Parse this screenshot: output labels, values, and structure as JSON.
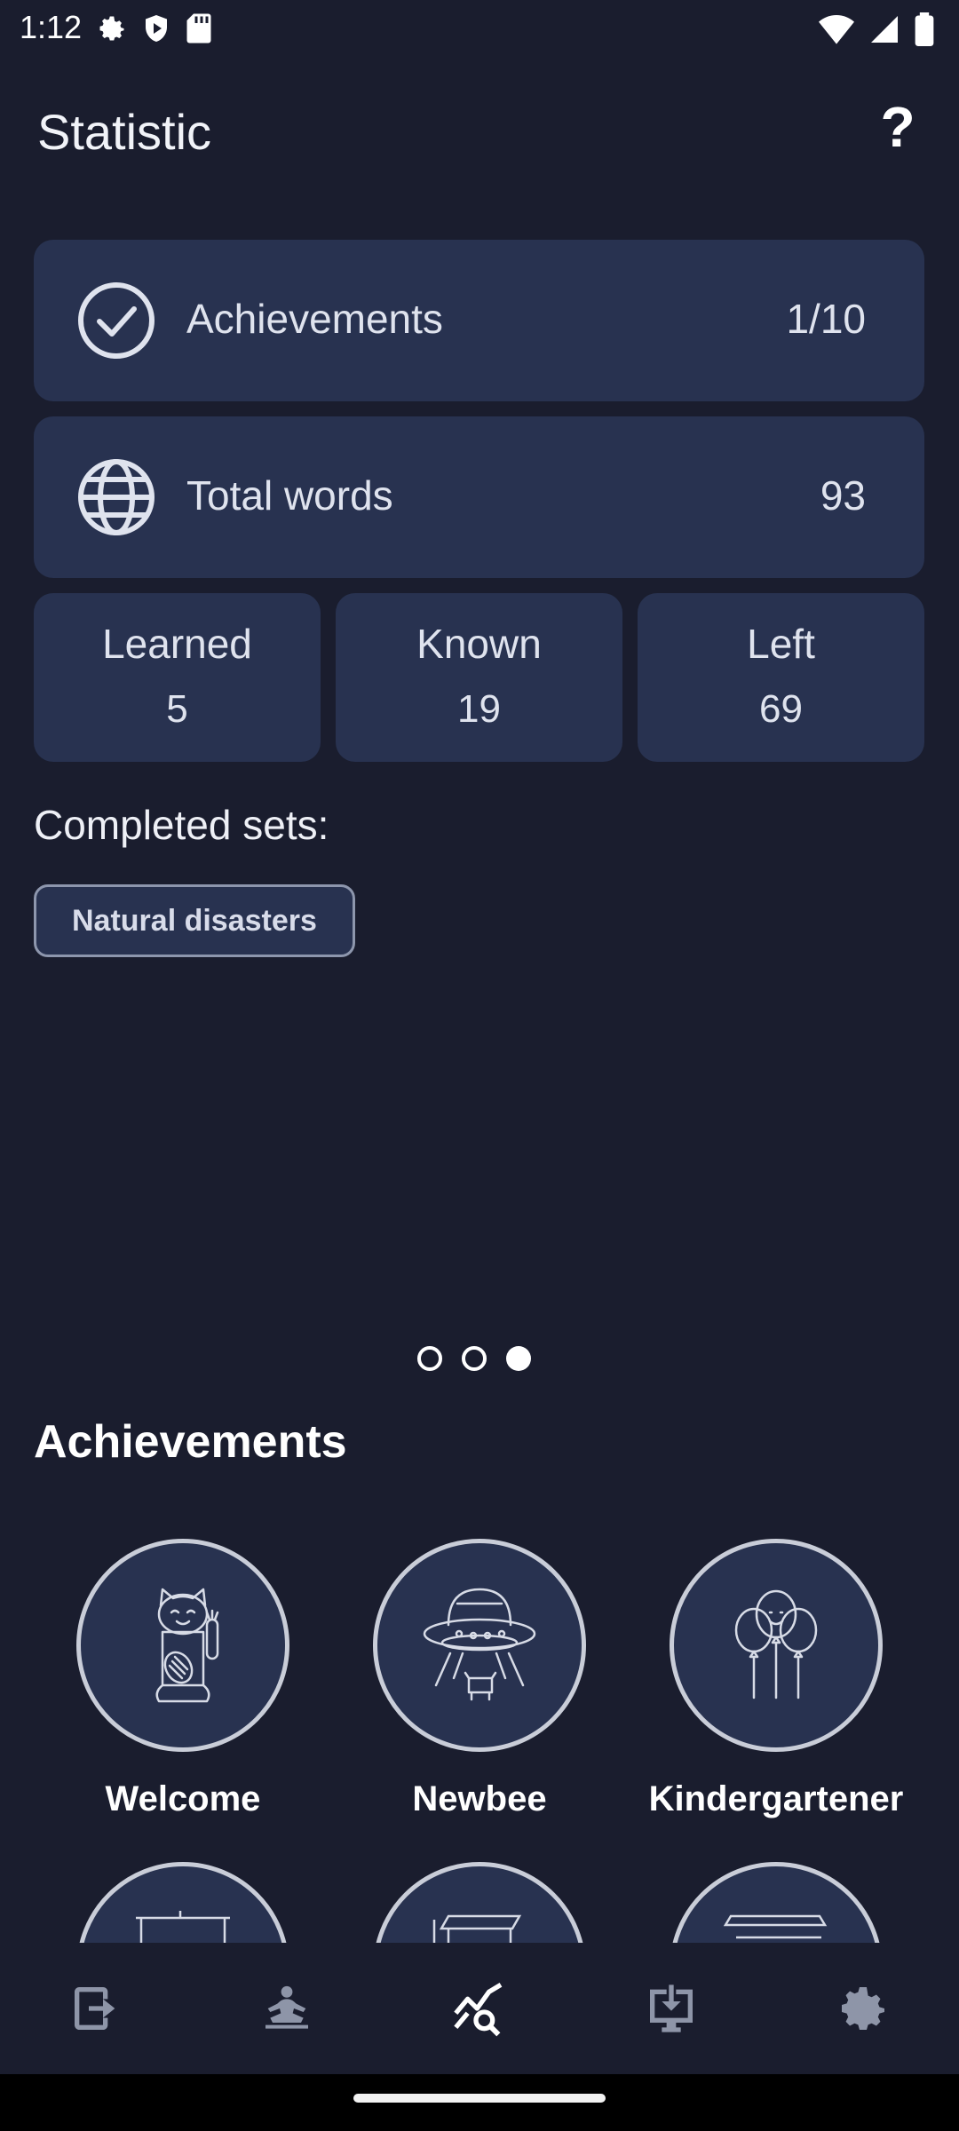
{
  "status_bar": {
    "time": "1:12"
  },
  "header": {
    "title": "Statistic",
    "help_label": "?"
  },
  "stats": {
    "achievements": {
      "label": "Achievements",
      "value": "1/10"
    },
    "total_words": {
      "label": "Total words",
      "value": "93"
    },
    "learned": {
      "label": "Learned",
      "value": "5"
    },
    "known": {
      "label": "Known",
      "value": "19"
    },
    "left": {
      "label": "Left",
      "value": "69"
    }
  },
  "completed_sets": {
    "title": "Completed sets:",
    "items": [
      "Natural disasters"
    ]
  },
  "pager": {
    "count": 3,
    "active_index": 2
  },
  "achievements_section": {
    "title": "Achievements",
    "badges": [
      {
        "label": "Welcome",
        "icon": "lucky-cat-icon"
      },
      {
        "label": "Newbee",
        "icon": "ufo-icon"
      },
      {
        "label": "Kindergartener",
        "icon": "balloons-icon"
      }
    ]
  },
  "bottom_nav": {
    "items": [
      "exit-icon",
      "meditation-icon",
      "statistics-icon",
      "download-icon",
      "settings-icon"
    ],
    "active": "statistics-icon"
  },
  "colors": {
    "background": "#1a1d2e",
    "card": "#283250",
    "text": "#e9ecf4"
  }
}
